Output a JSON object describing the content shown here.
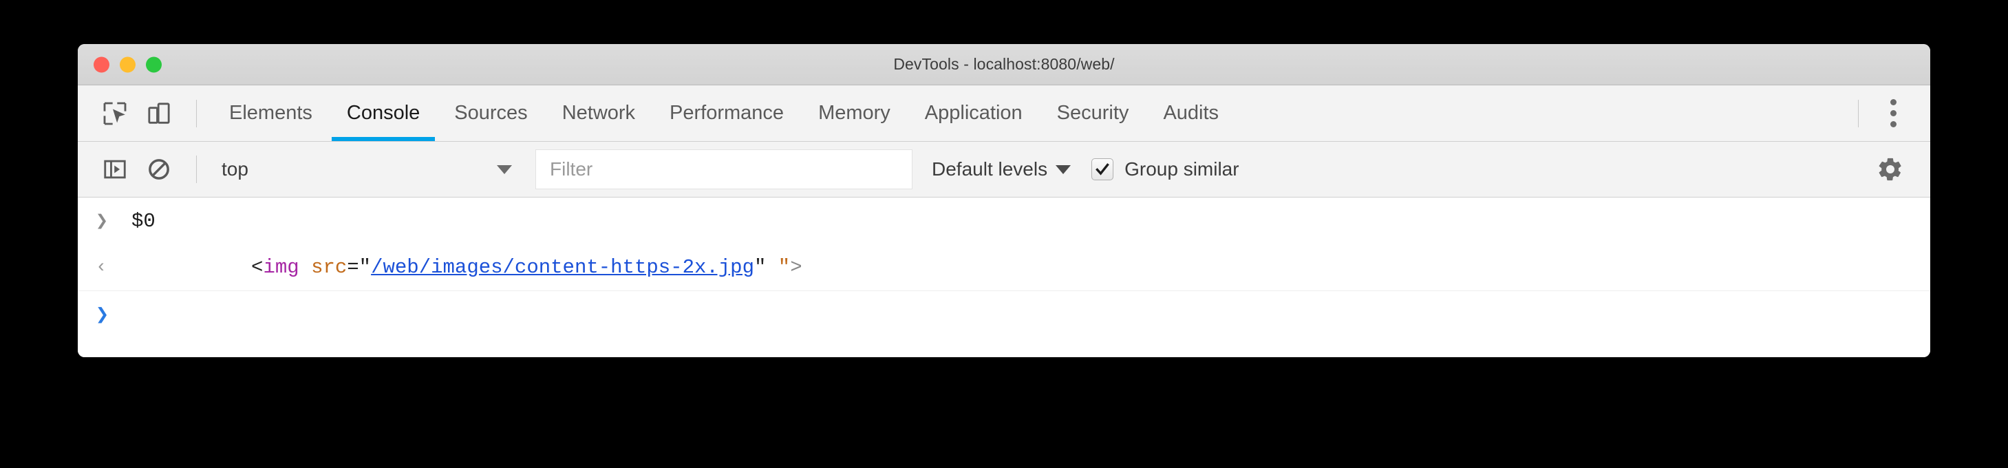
{
  "window": {
    "title": "DevTools - localhost:8080/web/",
    "traffic_lights": [
      {
        "name": "close",
        "color": "#ff6057"
      },
      {
        "name": "minimize",
        "color": "#ffbd2e"
      },
      {
        "name": "zoom",
        "color": "#2bc840"
      }
    ]
  },
  "toolbar": {
    "inspect_icon": "inspect-element-icon",
    "device_icon": "device-toolbar-icon",
    "more_icon": "kebab-menu-icon"
  },
  "tabs": [
    {
      "label": "Elements",
      "active": false
    },
    {
      "label": "Console",
      "active": true
    },
    {
      "label": "Sources",
      "active": false
    },
    {
      "label": "Network",
      "active": false
    },
    {
      "label": "Performance",
      "active": false
    },
    {
      "label": "Memory",
      "active": false
    },
    {
      "label": "Application",
      "active": false
    },
    {
      "label": "Security",
      "active": false
    },
    {
      "label": "Audits",
      "active": false
    }
  ],
  "console_toolbar": {
    "sidebar_icon": "console-sidebar-icon",
    "clear_icon": "clear-console-icon",
    "context": "top",
    "filter_placeholder": "Filter",
    "filter_value": "",
    "levels_label": "Default levels",
    "group_similar_label": "Group similar",
    "group_similar_checked": true,
    "settings_icon": "gear-icon"
  },
  "console_messages": [
    {
      "kind": "input",
      "prompt": "❯",
      "text": "$0"
    },
    {
      "kind": "output",
      "prompt": "‹",
      "tokens": [
        {
          "t": "<",
          "type": "punct"
        },
        {
          "t": "img",
          "type": "tag"
        },
        {
          "t": " ",
          "type": "punct"
        },
        {
          "t": "src",
          "type": "attr"
        },
        {
          "t": "=\"",
          "type": "punct"
        },
        {
          "t": "/web/images/content-https-2x.jpg",
          "type": "link"
        },
        {
          "t": "\"",
          "type": "punct"
        },
        {
          "t": " ",
          "type": "punct"
        },
        {
          "t": "\"",
          "type": "attr"
        },
        {
          "t": ">",
          "type": "gray"
        }
      ],
      "plain": "<img src=\"/web/images/content-https-2x.jpg\" \">"
    },
    {
      "kind": "prompt",
      "prompt": "❯",
      "text": ""
    }
  ],
  "colors": {
    "accent": "#00a2e8",
    "titlebar": "#d6d6d6",
    "toolbar_bg": "#f3f3f3",
    "body_bg": "#ffffff",
    "link": "#1a50d8",
    "tag": "#a626a4",
    "attr": "#c26b1b"
  }
}
